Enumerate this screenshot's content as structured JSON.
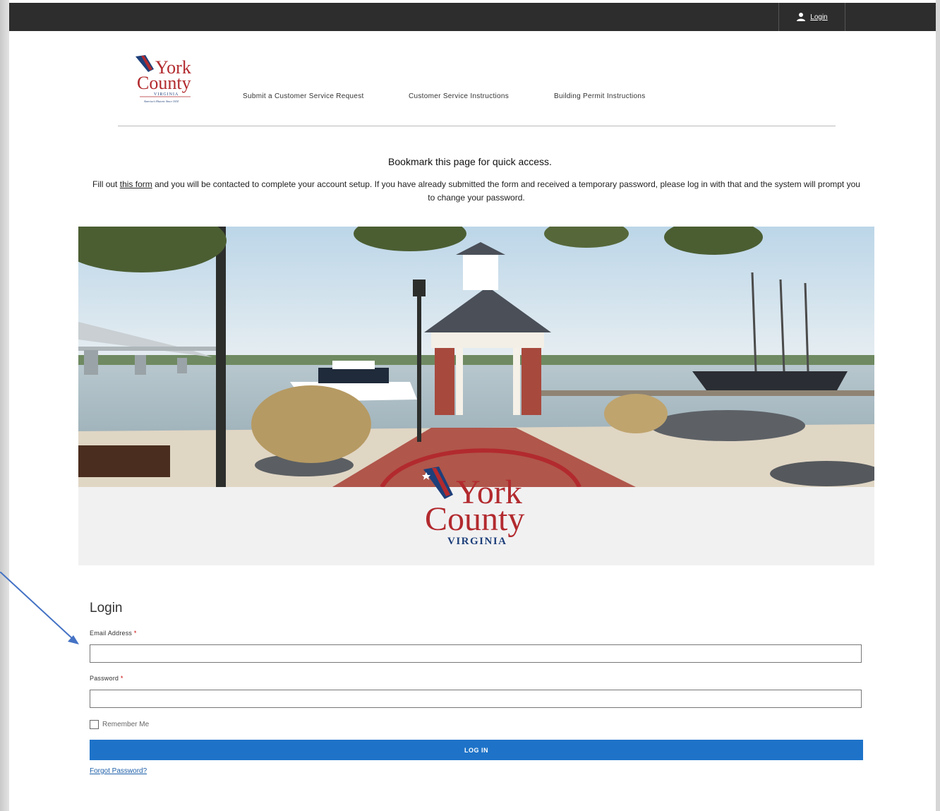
{
  "header": {
    "login_label": "Login"
  },
  "logo": {
    "line1": "York",
    "line2": "County",
    "line3": "VIRGINIA",
    "tagline": "America's Historic Since 1634"
  },
  "nav": {
    "items": [
      "Submit a Customer Service Request",
      "Customer Service Instructions",
      "Building Permit Instructions"
    ]
  },
  "notice": {
    "bookmark": "Bookmark this page for quick access.",
    "intro_before": "Fill out ",
    "intro_link": "this form",
    "intro_after": " and you will be contacted to complete your account setup. If you have already submitted the form and received a temporary password, please log in with that and the system will prompt you to change your password."
  },
  "banner_logo": {
    "line1": "York",
    "line2": "County",
    "line3": "VIRGINIA"
  },
  "login": {
    "title": "Login",
    "email_label": "Email Address",
    "password_label": "Password",
    "required_marker": "*",
    "email_value": "",
    "password_value": "",
    "remember_label": "Remember Me",
    "submit_label": "LOG IN",
    "forgot_label": "Forgot Password?"
  },
  "colors": {
    "topbar": "#2d2d2d",
    "button": "#1e73c8",
    "brand_red": "#b22a2e",
    "brand_blue": "#1d3f7a"
  }
}
